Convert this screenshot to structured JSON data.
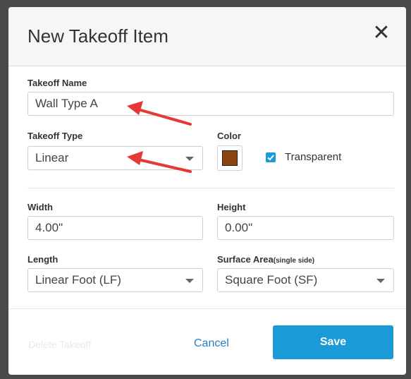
{
  "dialog": {
    "title": "New Takeoff Item",
    "close_icon": "close-icon"
  },
  "takeoff_name": {
    "label": "Takeoff Name",
    "value": "Wall Type A"
  },
  "takeoff_type": {
    "label": "Takeoff Type",
    "value": "Linear"
  },
  "color": {
    "label": "Color",
    "swatch": "#8B4513",
    "transparent_label": "Transparent",
    "transparent_checked": true
  },
  "width": {
    "label": "Width",
    "value": "4.00\""
  },
  "height": {
    "label": "Height",
    "value": "0.00\""
  },
  "length": {
    "label": "Length",
    "value": "Linear Foot (LF)"
  },
  "surface_area": {
    "label": "Surface Area",
    "label_suffix": "(single side)",
    "value": "Square Foot (SF)"
  },
  "footer": {
    "delete_label": "Delete Takeoff",
    "cancel_label": "Cancel",
    "save_label": "Save"
  },
  "colors": {
    "primary": "#1A9AD6",
    "link": "#1F80C4",
    "annotation_arrow": "#E53935"
  }
}
